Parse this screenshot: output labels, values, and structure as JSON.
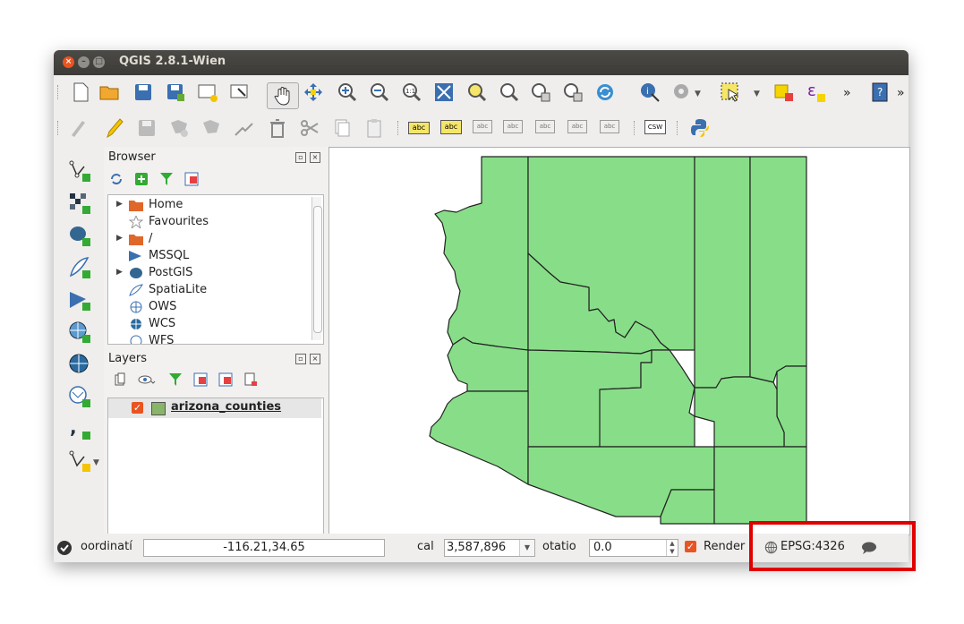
{
  "window": {
    "title": "QGIS 2.8.1-Wien"
  },
  "browser": {
    "title": "Browser",
    "items": [
      {
        "label": "Home"
      },
      {
        "label": "Favourites"
      },
      {
        "label": "/"
      },
      {
        "label": "MSSQL"
      },
      {
        "label": "PostGIS"
      },
      {
        "label": "SpatiaLite"
      },
      {
        "label": "OWS"
      },
      {
        "label": "WCS"
      },
      {
        "label": "WFS"
      }
    ]
  },
  "layers": {
    "title": "Layers",
    "items": [
      {
        "label": "arizona_counties",
        "checked": true,
        "color": "#89b56b"
      }
    ]
  },
  "map": {
    "fill_color": "#88de88",
    "stroke_color": "#222222"
  },
  "status": {
    "coordinate_label": "oordinatí",
    "coordinate_value": "-116.21,34.65",
    "scale_label": "cal",
    "scale_value": "3,587,896",
    "rotation_label": "otatio",
    "rotation_value": "0.0",
    "render_label": "Render",
    "render_checked": true,
    "crs": "EPSG:4326"
  },
  "toolbar": {
    "more": "»",
    "csw": "CSW",
    "abc": "abc"
  },
  "highlight_color": "#e10000"
}
